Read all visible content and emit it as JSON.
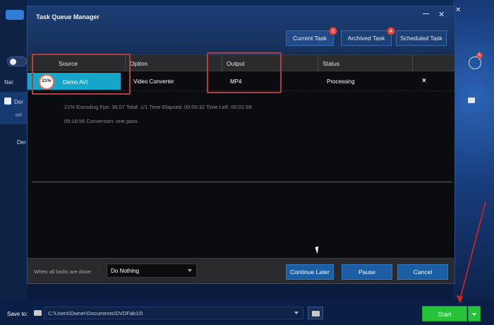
{
  "dialog": {
    "title": "Task Queue Manager",
    "tabs": [
      {
        "label": "Current Task",
        "badge": "1"
      },
      {
        "label": "Archived Task",
        "badge": "4"
      },
      {
        "label": "Scheduled Task",
        "badge": ""
      }
    ],
    "table": {
      "headers": [
        "Source",
        "Option",
        "Output",
        "Status"
      ],
      "row": {
        "progress": "21%",
        "source": "Demo AVI",
        "option": "Video Converter",
        "output": "MP4",
        "status": "Processing",
        "remove": "×"
      }
    },
    "details": {
      "line1": "21%  Encoding Fps: 39.07   Total: 1/1   Time Elapsed: 00:00:32  Time Left: 00:01:59",
      "line2": "09:16:56    Conversion: one pass"
    },
    "footer": {
      "label": "When all tasks are done:",
      "select_value": "Do Nothing",
      "buttons": {
        "continue_later": "Continue Later",
        "pause": "Pause",
        "cancel": "Cancel"
      }
    }
  },
  "app": {
    "save_to_label": "Save to:",
    "save_path": "C:\\Users\\Owner\\Documents\\DVDFab10\\",
    "start_label": "Start",
    "left_items": {
      "item1": "Nar",
      "item2": "Der",
      "item3": "Der",
      "badge": "MP"
    },
    "right_badge": "1"
  }
}
